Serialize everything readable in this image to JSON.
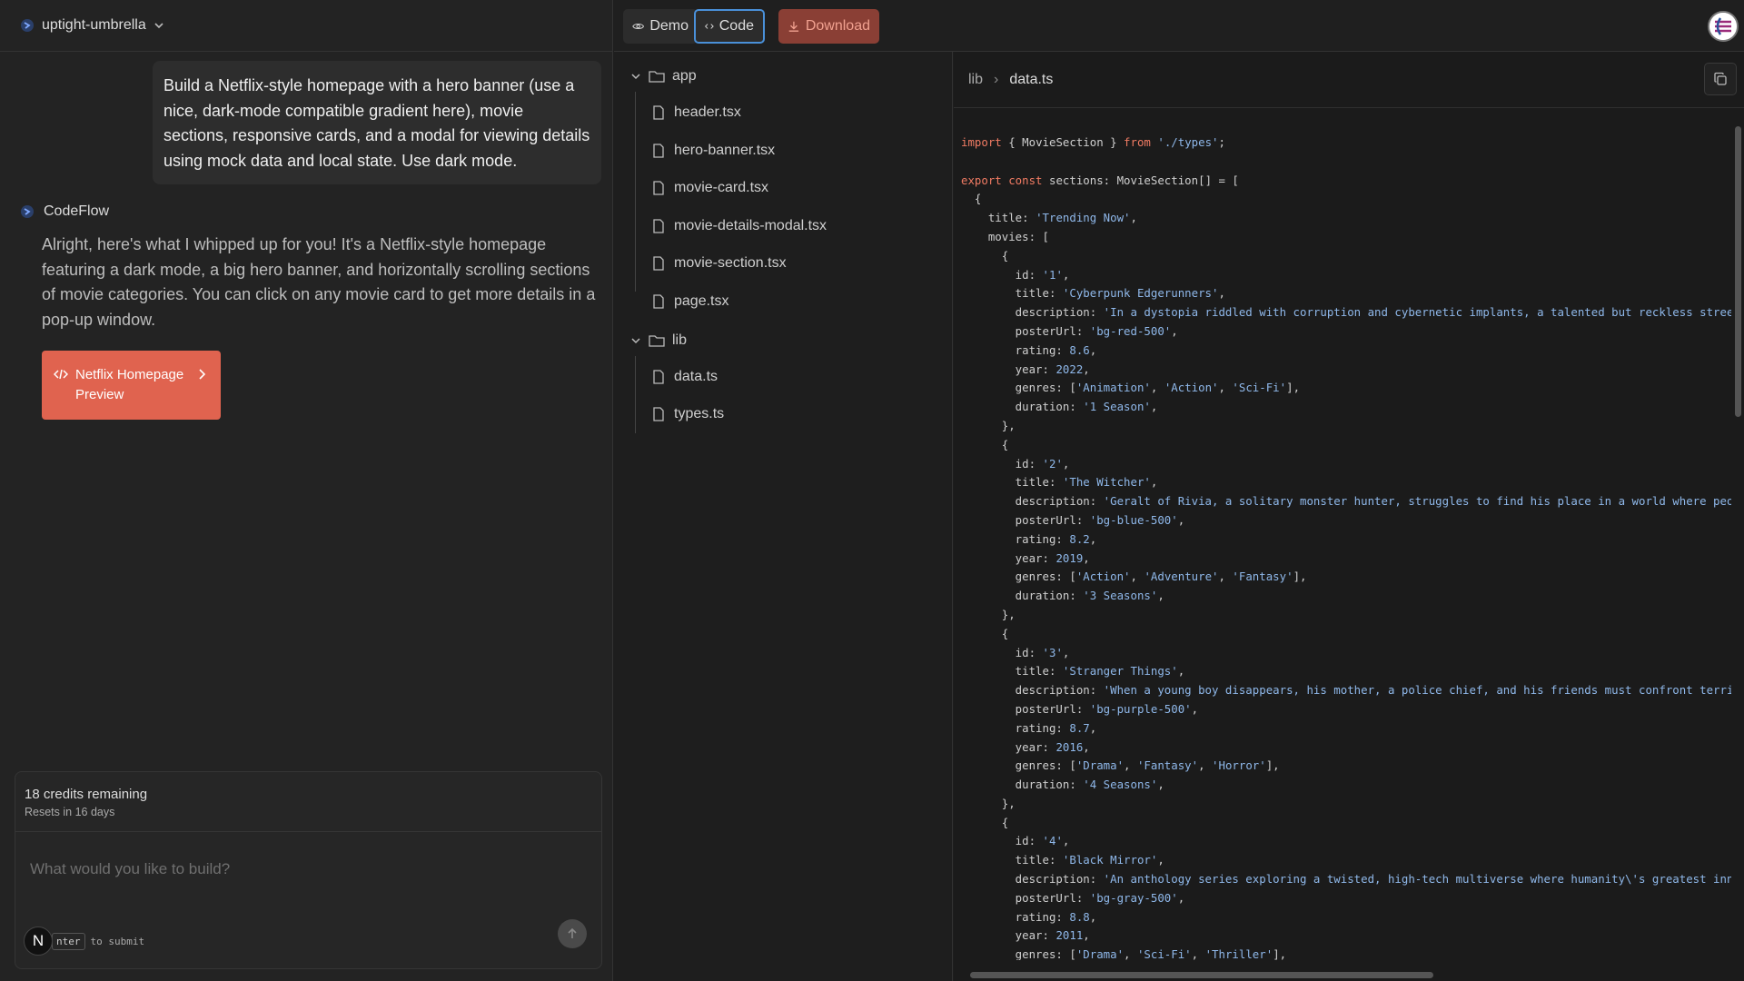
{
  "project": {
    "name": "uptight-umbrella"
  },
  "chat": {
    "user_message": "Build a Netflix-style homepage with a hero banner (use a nice, dark-mode compatible gradient here), movie sections, responsive cards, and a modal for viewing details using mock data and local state. Use dark mode.",
    "assistant_name": "CodeFlow",
    "assistant_message": "Alright, here's what I whipped up for you! It's a Netflix-style homepage featuring a dark mode, a big hero banner, and horizontally scrolling sections of movie categories. You can click on any movie card to get more details in a pop-up window.",
    "preview_button": "Netflix Homepage Preview"
  },
  "composer": {
    "credits": "18 credits remaining",
    "resets": "Resets in 16 days",
    "placeholder": "What would you like to build?",
    "hint_key": "nter",
    "hint_text": "to submit",
    "avatar_letter": "N"
  },
  "toolbar": {
    "demo": "Demo",
    "code": "Code",
    "download": "Download"
  },
  "tree": {
    "folders": [
      {
        "name": "app",
        "files": [
          "header.tsx",
          "hero-banner.tsx",
          "movie-card.tsx",
          "movie-details-modal.tsx",
          "movie-section.tsx",
          "page.tsx"
        ]
      },
      {
        "name": "lib",
        "files": [
          "data.ts",
          "types.ts"
        ]
      }
    ]
  },
  "editor": {
    "breadcrumb": [
      "lib",
      "data.ts"
    ],
    "lines": [
      [
        [
          "kw",
          "import"
        ],
        [
          "t",
          " { MovieSection } "
        ],
        [
          "kw",
          "from"
        ],
        [
          "t",
          " "
        ],
        [
          "str",
          "'./types'"
        ],
        [
          "t",
          ";"
        ]
      ],
      [],
      [
        [
          "kw",
          "export const"
        ],
        [
          "t",
          " sections: MovieSection[] = ["
        ]
      ],
      [
        [
          "t",
          "  {"
        ]
      ],
      [
        [
          "t",
          "    title: "
        ],
        [
          "str",
          "'Trending Now'"
        ],
        [
          "t",
          ","
        ]
      ],
      [
        [
          "t",
          "    movies: ["
        ]
      ],
      [
        [
          "t",
          "      {"
        ]
      ],
      [
        [
          "t",
          "        id: "
        ],
        [
          "str",
          "'1'"
        ],
        [
          "t",
          ","
        ]
      ],
      [
        [
          "t",
          "        title: "
        ],
        [
          "str",
          "'Cyberpunk Edgerunners'"
        ],
        [
          "t",
          ","
        ]
      ],
      [
        [
          "t",
          "        description: "
        ],
        [
          "str",
          "'In a dystopia riddled with corruption and cybernetic implants, a talented but reckless street k"
        ]
      ],
      [
        [
          "t",
          "        posterUrl: "
        ],
        [
          "str",
          "'bg-red-500'"
        ],
        [
          "t",
          ","
        ]
      ],
      [
        [
          "t",
          "        rating: "
        ],
        [
          "num",
          "8.6"
        ],
        [
          "t",
          ","
        ]
      ],
      [
        [
          "t",
          "        year: "
        ],
        [
          "num",
          "2022"
        ],
        [
          "t",
          ","
        ]
      ],
      [
        [
          "t",
          "        genres: ["
        ],
        [
          "str",
          "'Animation'"
        ],
        [
          "t",
          ", "
        ],
        [
          "str",
          "'Action'"
        ],
        [
          "t",
          ", "
        ],
        [
          "str",
          "'Sci-Fi'"
        ],
        [
          "t",
          "],"
        ]
      ],
      [
        [
          "t",
          "        duration: "
        ],
        [
          "str",
          "'1 Season'"
        ],
        [
          "t",
          ","
        ]
      ],
      [
        [
          "t",
          "      },"
        ]
      ],
      [
        [
          "t",
          "      {"
        ]
      ],
      [
        [
          "t",
          "        id: "
        ],
        [
          "str",
          "'2'"
        ],
        [
          "t",
          ","
        ]
      ],
      [
        [
          "t",
          "        title: "
        ],
        [
          "str",
          "'The Witcher'"
        ],
        [
          "t",
          ","
        ]
      ],
      [
        [
          "t",
          "        description: "
        ],
        [
          "str",
          "'Geralt of Rivia, a solitary monster hunter, struggles to find his place in a world where people"
        ]
      ],
      [
        [
          "t",
          "        posterUrl: "
        ],
        [
          "str",
          "'bg-blue-500'"
        ],
        [
          "t",
          ","
        ]
      ],
      [
        [
          "t",
          "        rating: "
        ],
        [
          "num",
          "8.2"
        ],
        [
          "t",
          ","
        ]
      ],
      [
        [
          "t",
          "        year: "
        ],
        [
          "num",
          "2019"
        ],
        [
          "t",
          ","
        ]
      ],
      [
        [
          "t",
          "        genres: ["
        ],
        [
          "str",
          "'Action'"
        ],
        [
          "t",
          ", "
        ],
        [
          "str",
          "'Adventure'"
        ],
        [
          "t",
          ", "
        ],
        [
          "str",
          "'Fantasy'"
        ],
        [
          "t",
          "],"
        ]
      ],
      [
        [
          "t",
          "        duration: "
        ],
        [
          "str",
          "'3 Seasons'"
        ],
        [
          "t",
          ","
        ]
      ],
      [
        [
          "t",
          "      },"
        ]
      ],
      [
        [
          "t",
          "      {"
        ]
      ],
      [
        [
          "t",
          "        id: "
        ],
        [
          "str",
          "'3'"
        ],
        [
          "t",
          ","
        ]
      ],
      [
        [
          "t",
          "        title: "
        ],
        [
          "str",
          "'Stranger Things'"
        ],
        [
          "t",
          ","
        ]
      ],
      [
        [
          "t",
          "        description: "
        ],
        [
          "str",
          "'When a young boy disappears, his mother, a police chief, and his friends must confront terrifyi"
        ]
      ],
      [
        [
          "t",
          "        posterUrl: "
        ],
        [
          "str",
          "'bg-purple-500'"
        ],
        [
          "t",
          ","
        ]
      ],
      [
        [
          "t",
          "        rating: "
        ],
        [
          "num",
          "8.7"
        ],
        [
          "t",
          ","
        ]
      ],
      [
        [
          "t",
          "        year: "
        ],
        [
          "num",
          "2016"
        ],
        [
          "t",
          ","
        ]
      ],
      [
        [
          "t",
          "        genres: ["
        ],
        [
          "str",
          "'Drama'"
        ],
        [
          "t",
          ", "
        ],
        [
          "str",
          "'Fantasy'"
        ],
        [
          "t",
          ", "
        ],
        [
          "str",
          "'Horror'"
        ],
        [
          "t",
          "],"
        ]
      ],
      [
        [
          "t",
          "        duration: "
        ],
        [
          "str",
          "'4 Seasons'"
        ],
        [
          "t",
          ","
        ]
      ],
      [
        [
          "t",
          "      },"
        ]
      ],
      [
        [
          "t",
          "      {"
        ]
      ],
      [
        [
          "t",
          "        id: "
        ],
        [
          "str",
          "'4'"
        ],
        [
          "t",
          ","
        ]
      ],
      [
        [
          "t",
          "        title: "
        ],
        [
          "str",
          "'Black Mirror'"
        ],
        [
          "t",
          ","
        ]
      ],
      [
        [
          "t",
          "        description: "
        ],
        [
          "str",
          "'An anthology series exploring a twisted, high-tech multiverse where humanity\\'s greatest innova"
        ]
      ],
      [
        [
          "t",
          "        posterUrl: "
        ],
        [
          "str",
          "'bg-gray-500'"
        ],
        [
          "t",
          ","
        ]
      ],
      [
        [
          "t",
          "        rating: "
        ],
        [
          "num",
          "8.8"
        ],
        [
          "t",
          ","
        ]
      ],
      [
        [
          "t",
          "        year: "
        ],
        [
          "num",
          "2011"
        ],
        [
          "t",
          ","
        ]
      ],
      [
        [
          "t",
          "        genres: ["
        ],
        [
          "str",
          "'Drama'"
        ],
        [
          "t",
          ", "
        ],
        [
          "str",
          "'Sci-Fi'"
        ],
        [
          "t",
          ", "
        ],
        [
          "str",
          "'Thriller'"
        ],
        [
          "t",
          "],"
        ]
      ]
    ]
  },
  "colors": {
    "accent": "#e0634f",
    "focus": "#4a90d9",
    "keyword": "#f07b63",
    "string": "#8fb8ea"
  }
}
